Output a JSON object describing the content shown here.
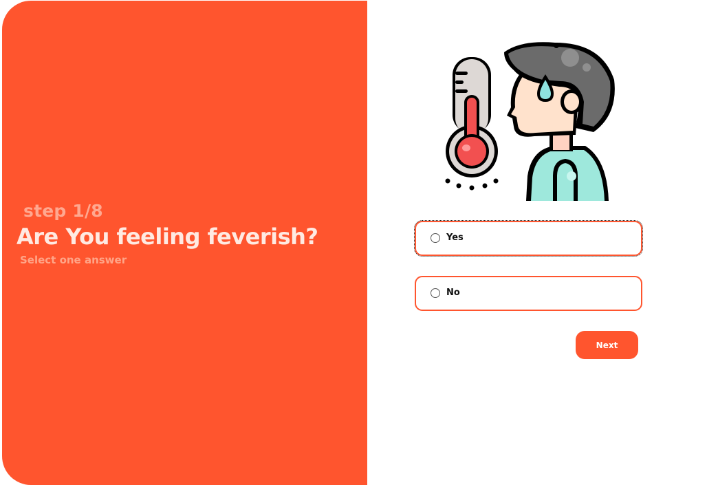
{
  "left": {
    "step": "step 1/8",
    "question": "Are You feeling feverish?",
    "subtitle": "Select one answer"
  },
  "illustration": {
    "icon": "fever-thermometer-person-icon",
    "colors": {
      "accent": "#ff552e",
      "hair": "#6b6b6b",
      "skin": "#ffe2cc",
      "shirt": "#9ee8dc",
      "thermometer_fill": "#f25050",
      "sweat": "#8ee3e0"
    }
  },
  "options": [
    {
      "label": "Yes",
      "selected": false,
      "focused": true
    },
    {
      "label": "No",
      "selected": false,
      "focused": false
    }
  ],
  "actions": {
    "next_label": "Next"
  },
  "colors": {
    "brand": "#ff552e",
    "background": "#ffffff"
  }
}
